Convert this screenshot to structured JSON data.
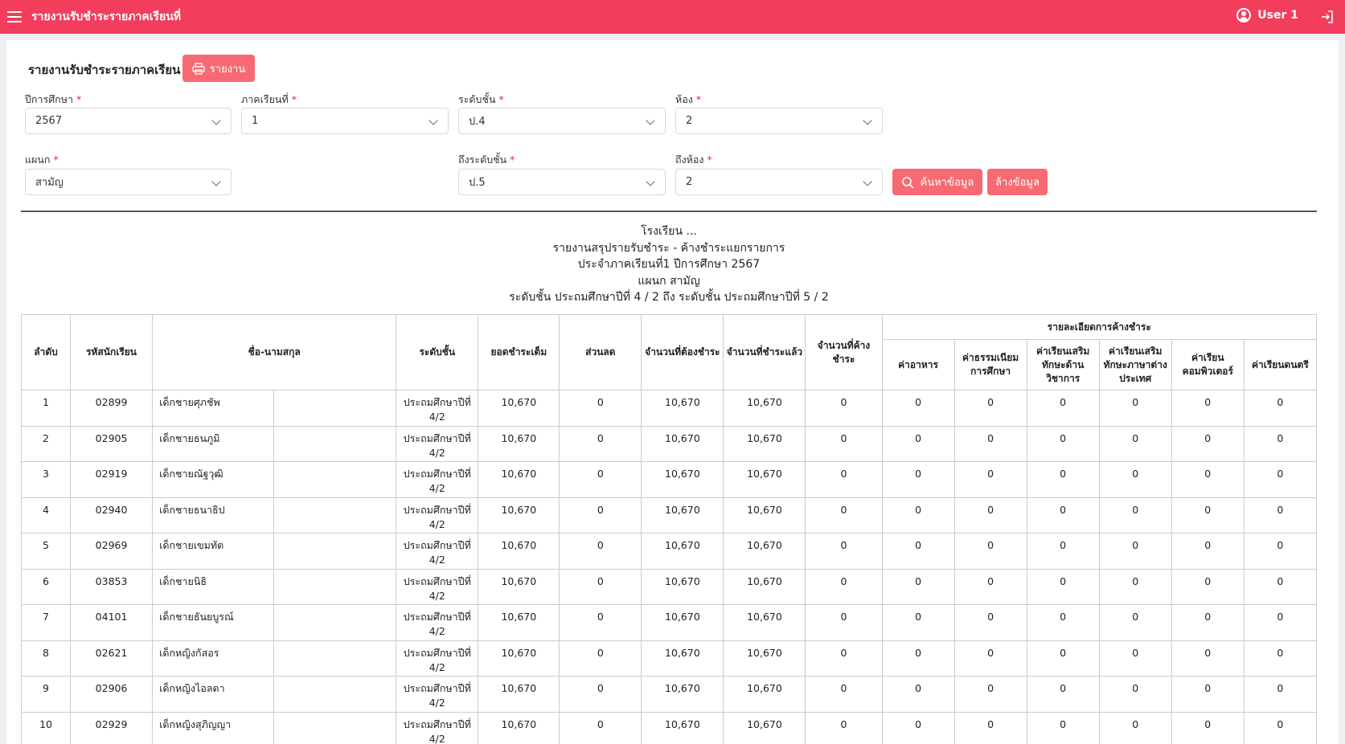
{
  "topbar": {
    "title": "รายงานรับชำระรายภาคเรียนที่",
    "user": "User 1"
  },
  "page": {
    "heading": "รายงานรับชำระรายภาคเรียน",
    "report_button": "รายงาน"
  },
  "form": {
    "year": {
      "label": "ปีการศึกษา",
      "value": "2567"
    },
    "term": {
      "label": "ภาคเรียนที่",
      "value": "1"
    },
    "level": {
      "label": "ระดับชั้น",
      "value": "ป.4"
    },
    "room": {
      "label": "ห้อง",
      "value": "2"
    },
    "dept": {
      "label": "แผนก",
      "value": "สามัญ"
    },
    "to_level": {
      "label": "ถึงระดับชั้น",
      "value": "ป.5"
    },
    "to_room": {
      "label": "ถึงห้อง",
      "value": "2"
    },
    "required_mark": "*",
    "search_button": "ค้นหาข้อมูล",
    "clear_button": "ล้างข้อมูล"
  },
  "report": {
    "school": "โรงเรียน ...",
    "title": "รายงานสรุปรายรับชำระ - ค้างชำระแยกรายการ",
    "term_line": "ประจำภาคเรียนที่1 ปีการศึกษา 2567",
    "dept_line": "แผนก สามัญ",
    "range_line": "ระดับชั้น ประถมศึกษาปีที่ 4 / 2 ถึง ระดับชั้น ประถมศึกษาปีที่ 5 / 2"
  },
  "table": {
    "headers": {
      "no": "ลำดับ",
      "code": "รหัสนักเรียน",
      "name": "ชื่อ-นามสกุล",
      "level": "ระดับชั้น",
      "full": "ยอดชำระเต็ม",
      "discount": "ส่วนลด",
      "due": "จำนวนที่ต้องชำระ",
      "paid": "จำนวนที่ชำระแล้ว",
      "owed": "จำนวนที่ค้างชำระ",
      "detail": "รายละเอียดการค้างชำระ",
      "sub": [
        "ค่าอาหาร",
        "ค่าธรรมเนียมการศึกษา",
        "ค่าเรียนเสริมทักษะด้านวิชาการ",
        "ค่าเรียนเสริมทักษะภาษาต่างประเทศ",
        "ค่าเรียนคอมพิวเตอร์",
        "ค่าเรียนดนตรี"
      ]
    },
    "rows": [
      {
        "no": "1",
        "code": "02899",
        "name": "เด็กชายศุภชัพ",
        "level": "ประถมศึกษาปีที่ 4/2",
        "full": "10,670",
        "discount": "0",
        "due": "10,670",
        "paid": "10,670",
        "owed": "0",
        "d": [
          "0",
          "0",
          "0",
          "0",
          "0",
          "0"
        ]
      },
      {
        "no": "2",
        "code": "02905",
        "name": "เด็กชายธนภูมิ",
        "level": "ประถมศึกษาปีที่ 4/2",
        "full": "10,670",
        "discount": "0",
        "due": "10,670",
        "paid": "10,670",
        "owed": "0",
        "d": [
          "0",
          "0",
          "0",
          "0",
          "0",
          "0"
        ]
      },
      {
        "no": "3",
        "code": "02919",
        "name": "เด็กชายณัฐวุฒิ",
        "level": "ประถมศึกษาปีที่ 4/2",
        "full": "10,670",
        "discount": "0",
        "due": "10,670",
        "paid": "10,670",
        "owed": "0",
        "d": [
          "0",
          "0",
          "0",
          "0",
          "0",
          "0"
        ]
      },
      {
        "no": "4",
        "code": "02940",
        "name": "เด็กชายธนาธิป",
        "level": "ประถมศึกษาปีที่ 4/2",
        "full": "10,670",
        "discount": "0",
        "due": "10,670",
        "paid": "10,670",
        "owed": "0",
        "d": [
          "0",
          "0",
          "0",
          "0",
          "0",
          "0"
        ]
      },
      {
        "no": "5",
        "code": "02969",
        "name": "เด็กชายเขมทัต",
        "level": "ประถมศึกษาปีที่ 4/2",
        "full": "10,670",
        "discount": "0",
        "due": "10,670",
        "paid": "10,670",
        "owed": "0",
        "d": [
          "0",
          "0",
          "0",
          "0",
          "0",
          "0"
        ]
      },
      {
        "no": "6",
        "code": "03853",
        "name": "เด็กชายนิธิ",
        "level": "ประถมศึกษาปีที่ 4/2",
        "full": "10,670",
        "discount": "0",
        "due": "10,670",
        "paid": "10,670",
        "owed": "0",
        "d": [
          "0",
          "0",
          "0",
          "0",
          "0",
          "0"
        ]
      },
      {
        "no": "7",
        "code": "04101",
        "name": "เด็กชายธันยบูรณ์",
        "level": "ประถมศึกษาปีที่ 4/2",
        "full": "10,670",
        "discount": "0",
        "due": "10,670",
        "paid": "10,670",
        "owed": "0",
        "d": [
          "0",
          "0",
          "0",
          "0",
          "0",
          "0"
        ]
      },
      {
        "no": "8",
        "code": "02621",
        "name": "เด็กหญิงกัสอร",
        "level": "ประถมศึกษาปีที่ 4/2",
        "full": "10,670",
        "discount": "0",
        "due": "10,670",
        "paid": "10,670",
        "owed": "0",
        "d": [
          "0",
          "0",
          "0",
          "0",
          "0",
          "0"
        ]
      },
      {
        "no": "9",
        "code": "02906",
        "name": "เด็กหญิงไอลดา",
        "level": "ประถมศึกษาปีที่ 4/2",
        "full": "10,670",
        "discount": "0",
        "due": "10,670",
        "paid": "10,670",
        "owed": "0",
        "d": [
          "0",
          "0",
          "0",
          "0",
          "0",
          "0"
        ]
      },
      {
        "no": "10",
        "code": "02929",
        "name": "เด็กหญิงสุภิญญา",
        "level": "ประถมศึกษาปีที่ 4/2",
        "full": "10,670",
        "discount": "0",
        "due": "10,670",
        "paid": "10,670",
        "owed": "0",
        "d": [
          "0",
          "0",
          "0",
          "0",
          "0",
          "0"
        ]
      }
    ]
  }
}
